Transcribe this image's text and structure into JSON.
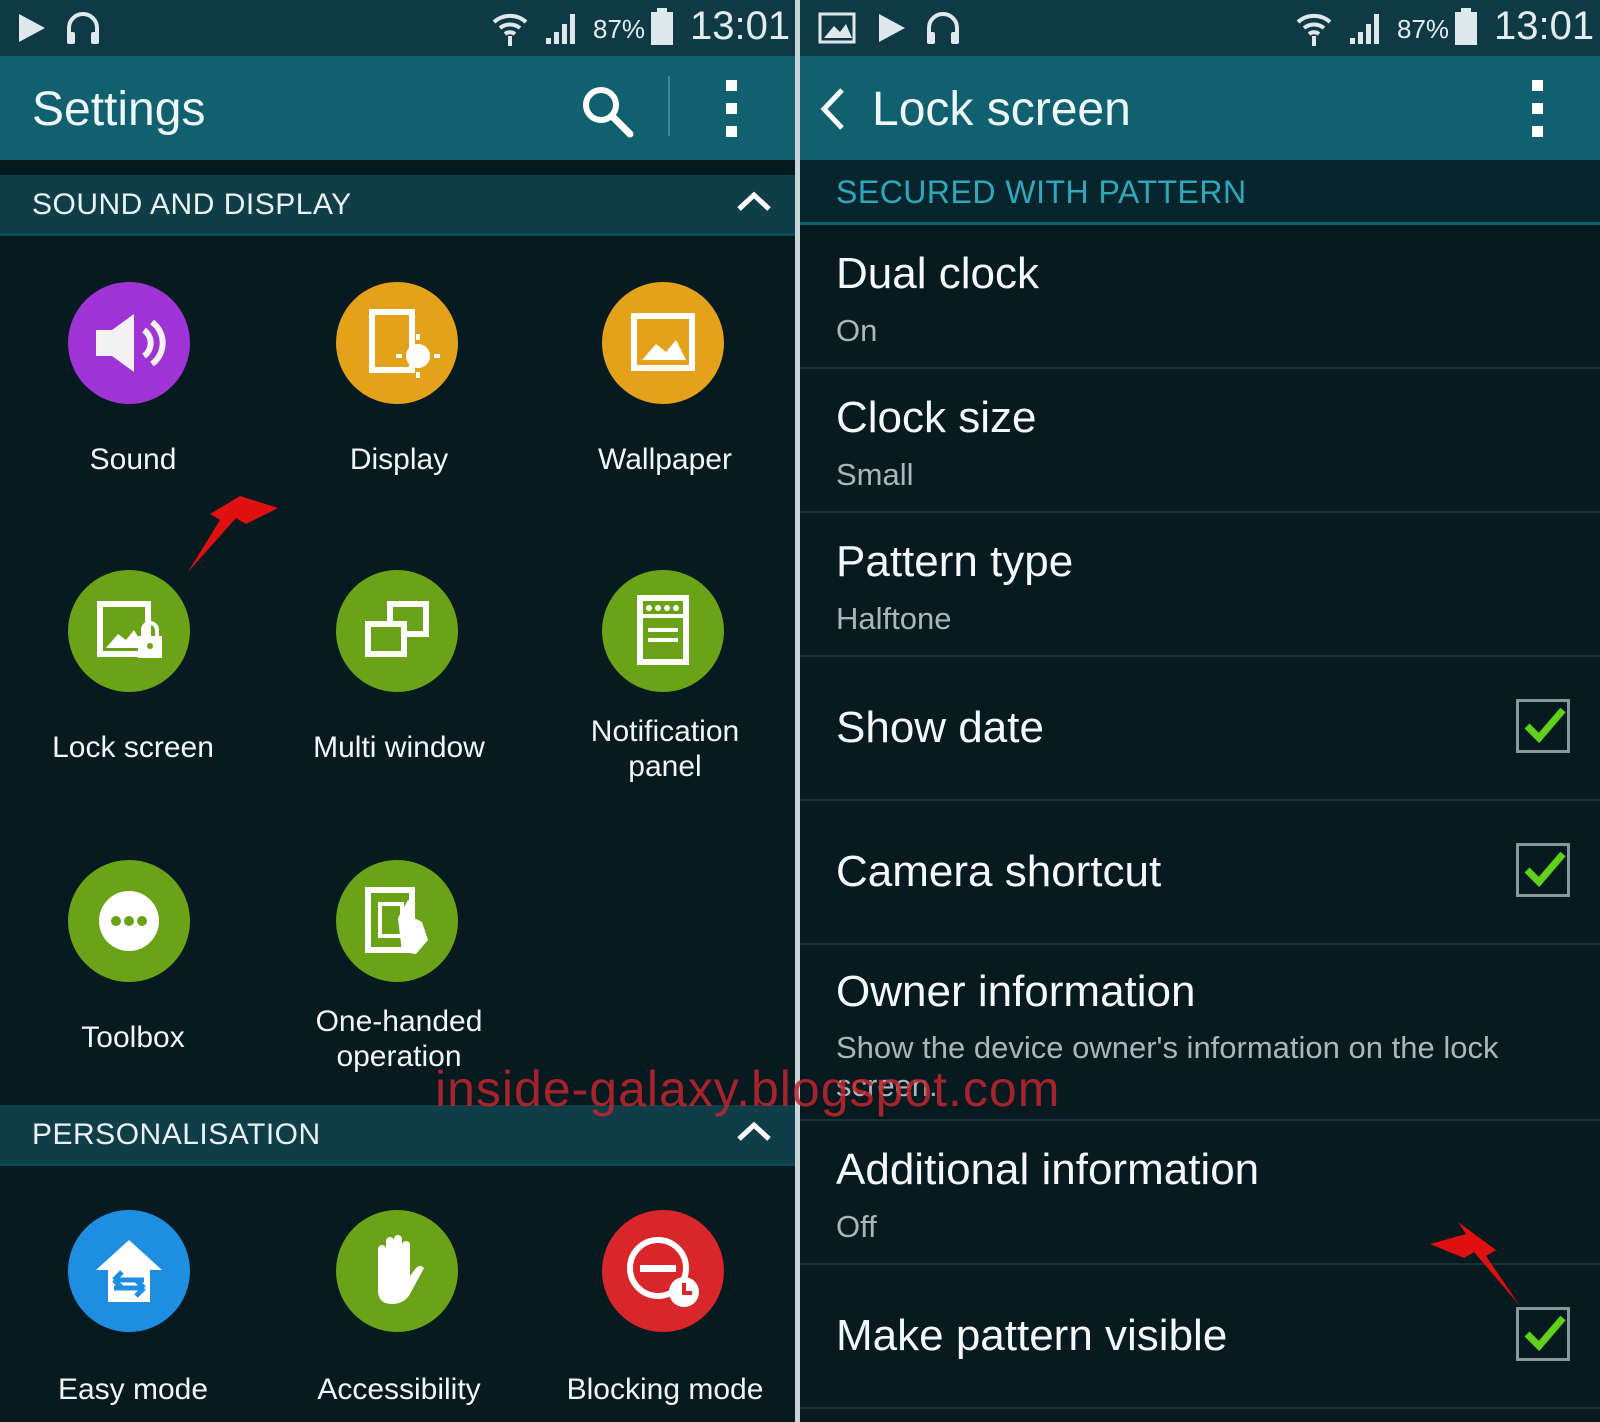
{
  "left": {
    "status": {
      "battery": "87%",
      "time": "13:01"
    },
    "appbar": {
      "title": "Settings"
    },
    "section1": {
      "label": "SOUND AND DISPLAY"
    },
    "tiles": [
      {
        "label": "Sound",
        "icon": "speaker-icon",
        "color": "#a033d6"
      },
      {
        "label": "Display",
        "icon": "display-brightness-icon",
        "color": "#e4a21b"
      },
      {
        "label": "Wallpaper",
        "icon": "wallpaper-icon",
        "color": "#e4a21b"
      },
      {
        "label": "Lock screen",
        "icon": "lock-screen-icon",
        "color": "#6aa317"
      },
      {
        "label": "Multi window",
        "icon": "multi-window-icon",
        "color": "#6aa317"
      },
      {
        "label": "Notification\npanel",
        "icon": "notification-panel-icon",
        "color": "#6aa317"
      },
      {
        "label": "Toolbox",
        "icon": "toolbox-icon",
        "color": "#6aa317"
      },
      {
        "label": "One-handed\noperation",
        "icon": "one-handed-icon",
        "color": "#6aa317"
      }
    ],
    "section2": {
      "label": "PERSONALISATION"
    },
    "tiles2": [
      {
        "label": "Easy mode",
        "icon": "easy-mode-icon",
        "color": "#1e8fe0"
      },
      {
        "label": "Accessibility",
        "icon": "accessibility-hand-icon",
        "color": "#6aa317"
      },
      {
        "label": "Blocking mode",
        "icon": "blocking-mode-icon",
        "color": "#d8262a"
      }
    ]
  },
  "right": {
    "status": {
      "battery": "87%",
      "time": "13:01"
    },
    "appbar": {
      "title": "Lock screen"
    },
    "section": {
      "label": "SECURED WITH PATTERN"
    },
    "rows": [
      {
        "title": "Dual clock",
        "summary": "On"
      },
      {
        "title": "Clock size",
        "summary": "Small"
      },
      {
        "title": "Pattern type",
        "summary": "Halftone"
      },
      {
        "title": "Show date",
        "checked": true
      },
      {
        "title": "Camera shortcut",
        "checked": true
      },
      {
        "title": "Owner information",
        "summary": "Show the device owner's information on the lock screen."
      },
      {
        "title": "Additional information",
        "summary": "Off"
      },
      {
        "title": "Make pattern visible",
        "checked": true
      }
    ]
  },
  "watermark": "inside-galaxy.blogspot.com",
  "colors": {
    "accent": "#2fa8bd",
    "check": "#5fd11c",
    "arrow": "#e01010"
  }
}
